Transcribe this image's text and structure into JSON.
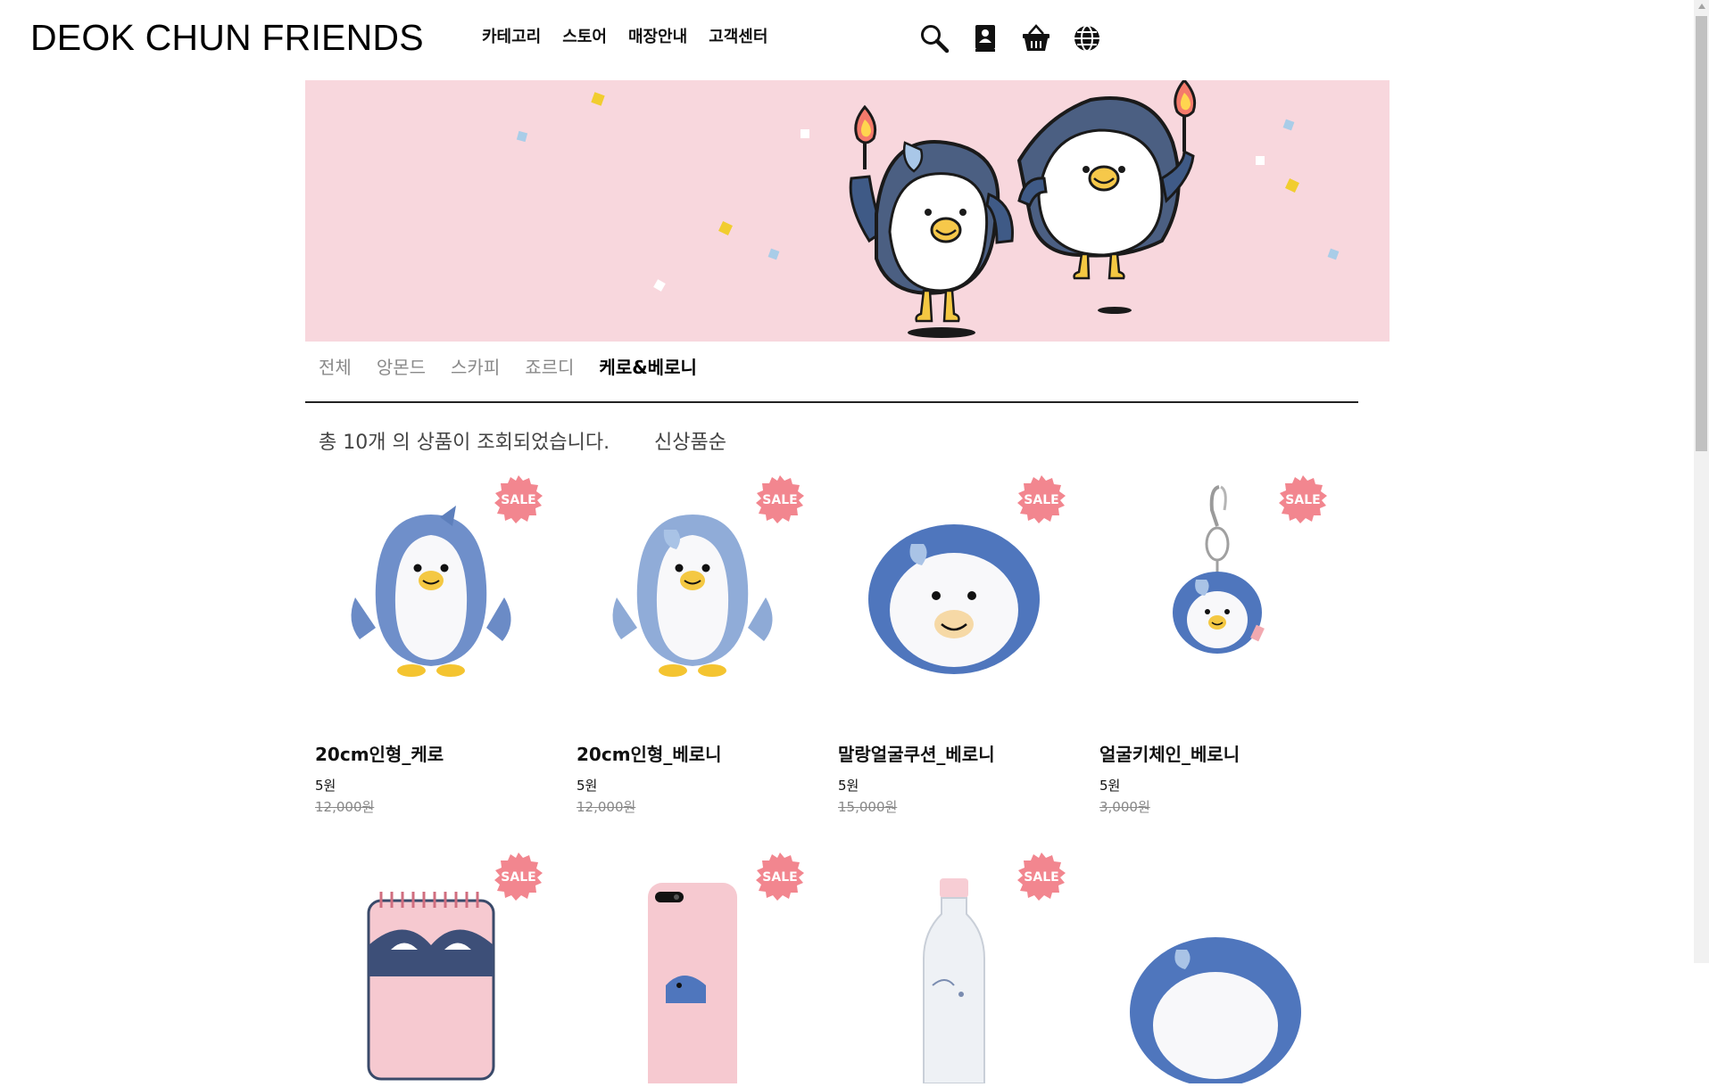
{
  "header": {
    "brand": "DEOK CHUN FRIENDS",
    "nav": [
      "카테고리",
      "스토어",
      "매장안내",
      "고객센터"
    ],
    "icons": [
      "search-icon",
      "profile-book-icon",
      "basket-icon",
      "globe-icon"
    ]
  },
  "colors": {
    "banner_bg": "#f8d7dd",
    "sale_badge": "#f2868f",
    "penguin_blue": "#5b7fbf",
    "beak_yellow": "#f4c842"
  },
  "tabs": [
    {
      "label": "전체",
      "active": false
    },
    {
      "label": "앙몬드",
      "active": false
    },
    {
      "label": "스카피",
      "active": false
    },
    {
      "label": "죠르디",
      "active": false
    },
    {
      "label": "케로&베로니",
      "active": true
    }
  ],
  "results": {
    "summary": "총 10개 의 상품이 조회되었습니다.",
    "sort_label": "신상품순"
  },
  "products": [
    {
      "name": "20cm인형_케로",
      "price": "5원",
      "original_price": "12,000원",
      "badge": "SALE",
      "image": "penguin-plush-kero"
    },
    {
      "name": "20cm인형_베로니",
      "price": "5원",
      "original_price": "12,000원",
      "badge": "SALE",
      "image": "penguin-plush-beroni"
    },
    {
      "name": "말랑얼굴쿠션_베로니",
      "price": "5원",
      "original_price": "15,000원",
      "badge": "SALE",
      "image": "face-cushion-beroni"
    },
    {
      "name": "얼굴키체인_베로니",
      "price": "5원",
      "original_price": "3,000원",
      "badge": "SALE",
      "image": "keychain-beroni"
    },
    {
      "name": "",
      "price": "",
      "original_price": "",
      "badge": "SALE",
      "image": "spiral-notebook"
    },
    {
      "name": "",
      "price": "",
      "original_price": "",
      "badge": "SALE",
      "image": "phone-case"
    },
    {
      "name": "",
      "price": "",
      "original_price": "",
      "badge": "SALE",
      "image": "water-bottle"
    },
    {
      "name": "",
      "price": "",
      "original_price": "",
      "badge": "",
      "image": "cushion-partial"
    }
  ]
}
